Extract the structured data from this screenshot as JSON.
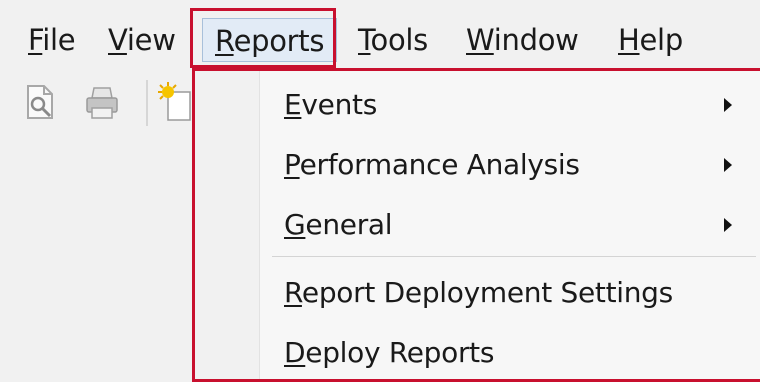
{
  "menubar": {
    "items": [
      {
        "first": "F",
        "rest": "ile"
      },
      {
        "first": "V",
        "rest": "iew"
      },
      {
        "first": "R",
        "rest": "eports"
      },
      {
        "first": "T",
        "rest": "ools"
      },
      {
        "first": "W",
        "rest": "indow"
      },
      {
        "first": "H",
        "rest": "elp"
      }
    ]
  },
  "dropdown": {
    "items": [
      {
        "first": "E",
        "rest": "vents",
        "submenu": true
      },
      {
        "first": "P",
        "rest": "erformance Analysis",
        "submenu": true
      },
      {
        "first": "G",
        "rest": "eneral",
        "submenu": true
      },
      {
        "first": "R",
        "rest": "eport Deployment Settings",
        "submenu": false
      },
      {
        "first": "D",
        "rest": "eploy Reports",
        "submenu": false
      }
    ]
  },
  "colors": {
    "highlight_border": "#c8102e",
    "menu_hover": "#e2ebf6"
  },
  "icons": [
    "print-preview-icon",
    "print-icon",
    "new-report-icon"
  ]
}
